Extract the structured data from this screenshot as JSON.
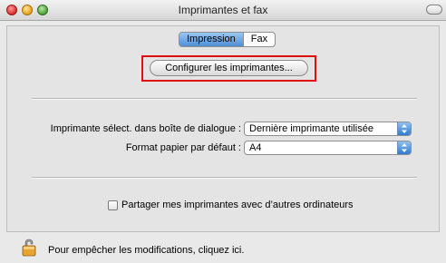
{
  "window": {
    "title": "Imprimantes et fax"
  },
  "tabs": [
    {
      "label": "Impression",
      "selected": true
    },
    {
      "label": "Fax",
      "selected": false
    }
  ],
  "configure_button": {
    "label": "Configurer les imprimantes..."
  },
  "dialog_printer": {
    "label": "Imprimante sélect. dans boîte de dialogue :",
    "value": "Dernière imprimante utilisée"
  },
  "paper_format": {
    "label": "Format papier par défaut :",
    "value": "A4"
  },
  "share_printers": {
    "label": "Partager mes imprimantes avec d’autres ordinateurs",
    "checked": false
  },
  "lock": {
    "text": "Pour empêcher les modifications, cliquez ici.",
    "icon": "lock-icon"
  },
  "colors": {
    "highlight": "#e01010",
    "accent": "#4f8ed6"
  }
}
